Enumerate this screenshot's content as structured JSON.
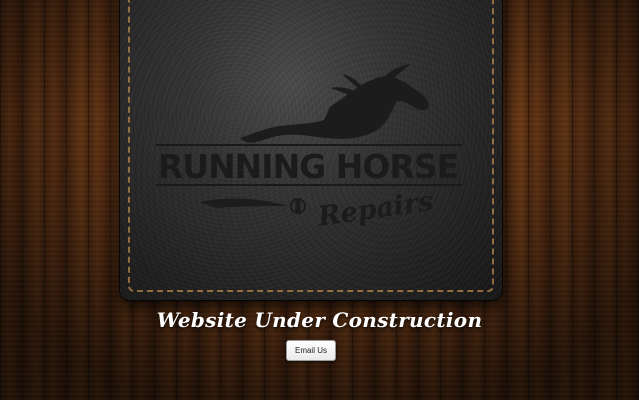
{
  "logo": {
    "line1": "RUNNING HORSE",
    "line2": "Repairs"
  },
  "tagline": "Website Under Construction",
  "email_button": {
    "label": "Email Us"
  },
  "colors": {
    "wood": "#6a3514",
    "leather": "#2b2b2b",
    "stitching": "#b8894a",
    "tagline_text": "#ffffff"
  }
}
